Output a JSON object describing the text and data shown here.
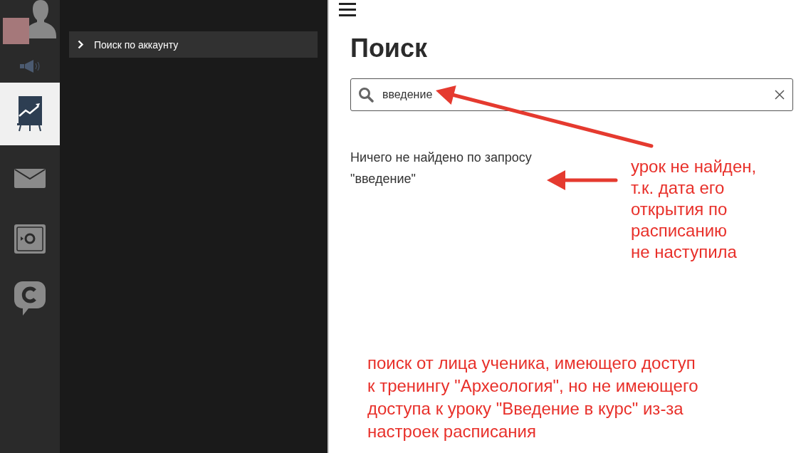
{
  "rail": [
    {
      "kind": "avatar",
      "selected": false
    },
    {
      "kind": "sound",
      "selected": false
    },
    {
      "kind": "chart",
      "selected": true
    },
    {
      "kind": "mail",
      "selected": false
    },
    {
      "kind": "safe",
      "selected": false
    },
    {
      "kind": "chat",
      "selected": false
    }
  ],
  "panel": {
    "items": [
      {
        "label": "Поиск по аккаунту",
        "expanded": false
      }
    ]
  },
  "main": {
    "title": "Поиск",
    "search": {
      "value": "введение"
    },
    "result": "Ничего не найдено по запросу \"введение\""
  },
  "annotations": [
    {
      "lines": [
        "урок не найден,",
        "т.к. дата его",
        "открытия по",
        "расписанию",
        "не наступила"
      ]
    },
    {
      "lines": [
        "поиск от лица ученика, имеющего доступ",
        "к тренингу \"Археология\", но не имеющего",
        "доступа к уроку \"Введение в курс\" из-за",
        "настроек расписания"
      ]
    }
  ]
}
